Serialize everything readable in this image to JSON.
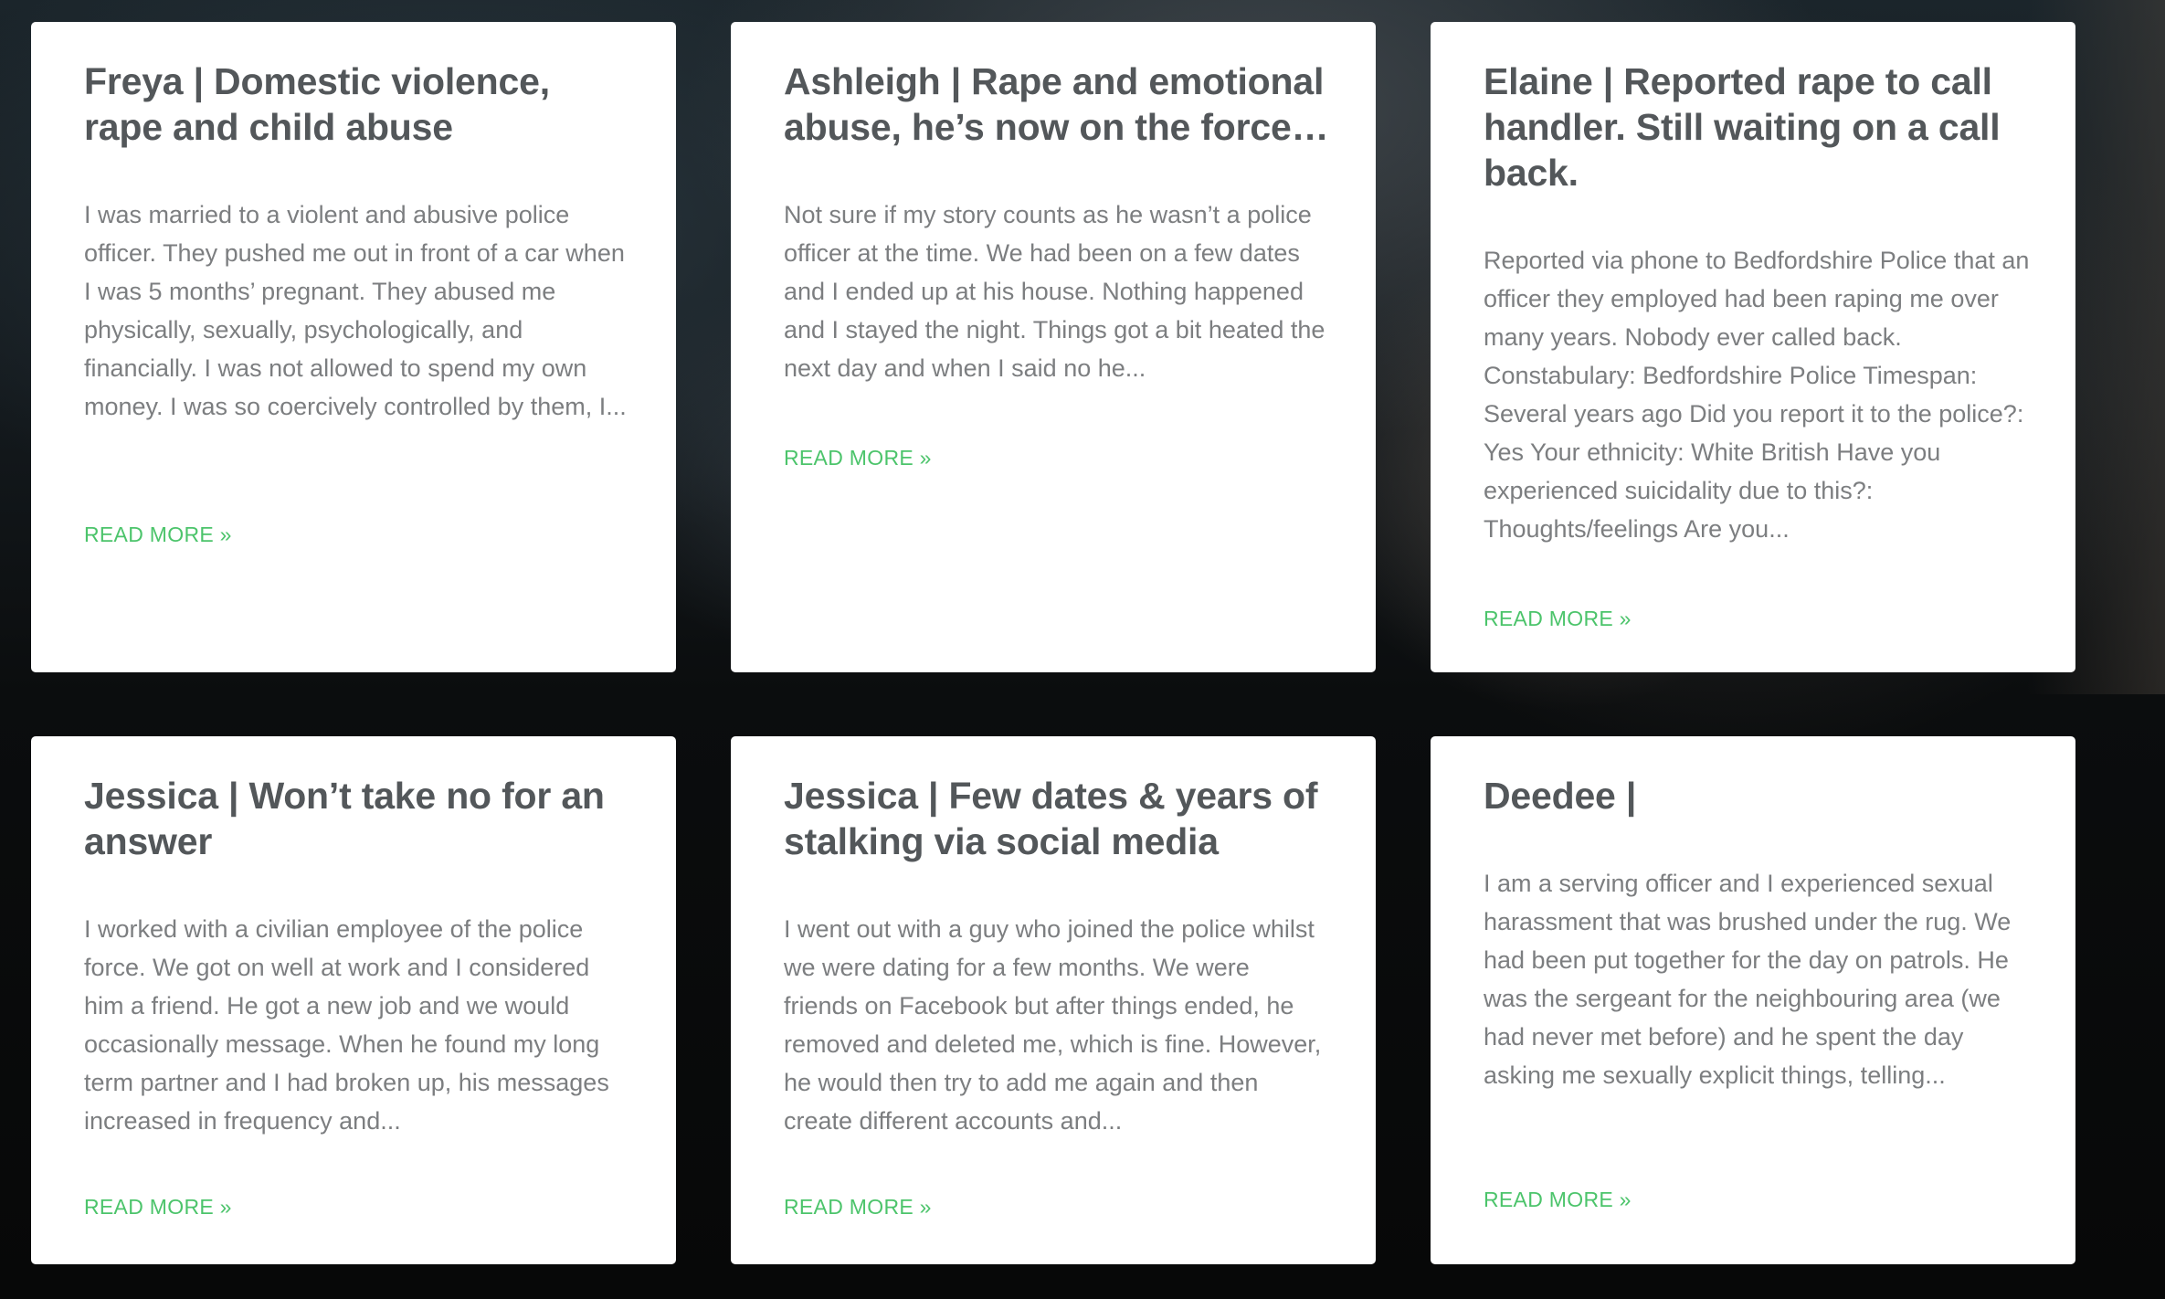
{
  "cards": [
    {
      "title": "Freya | Domestic violence, rape and child abuse",
      "excerpt": "I was married to a violent and abusive police officer. They pushed me out in front of a car when I was 5 months’ pregnant. They abused me physically, sexually, psychologically, and financially. I was not allowed to spend my own money. I was so coercively controlled by them, I...",
      "read_more": "READ MORE »"
    },
    {
      "title": "Ashleigh | Rape and emotional abuse, he’s now on the force…",
      "excerpt": "Not sure if my story counts as he wasn’t a police officer at the time. We had been on a few dates and I ended up at his house. Nothing happened and I stayed the night. Things got a bit heated the next day and when I said no he...",
      "read_more": "READ MORE »"
    },
    {
      "title": "Elaine | Reported rape to call handler. Still waiting on a call back.",
      "excerpt": "Reported via phone to Bedfordshire Police that an officer they employed had been raping me over many years. Nobody ever called back. Constabulary: Bedfordshire Police Timespan: Several years ago Did you report it to the police?: Yes Your ethnicity: White British Have you experienced suicidality due to this?: Thoughts/feelings Are you...",
      "read_more": "READ MORE »"
    },
    {
      "title": "Jessica | Won’t take no for an answer",
      "excerpt": "I worked with a civilian employee of the police force. We got on well at work and I considered him a friend. He got a new job and we would occasionally message. When he found my long term partner and I had broken up, his messages increased in frequency and...",
      "read_more": "READ MORE »"
    },
    {
      "title": "Jessica | Few dates & years of stalking via social media",
      "excerpt": "I went out with a guy who joined the police whilst we were dating for a few months. We were friends on Facebook but after things ended, he removed and deleted me, which is fine. However, he would then try to add me again and then create different accounts and...",
      "read_more": "READ MORE »"
    },
    {
      "title": "Deedee |",
      "excerpt": "I am a serving officer and I experienced sexual harassment that was brushed under the rug. We had been put together for the day on patrols. He was the sergeant for the neighbouring area (we had never met before) and he spent the day asking me sexually explicit things, telling...",
      "read_more": "READ MORE »"
    }
  ],
  "colors": {
    "card_background": "#ffffff",
    "title": "#53575a",
    "excerpt": "#7c7e80",
    "link": "#4cc46b"
  }
}
